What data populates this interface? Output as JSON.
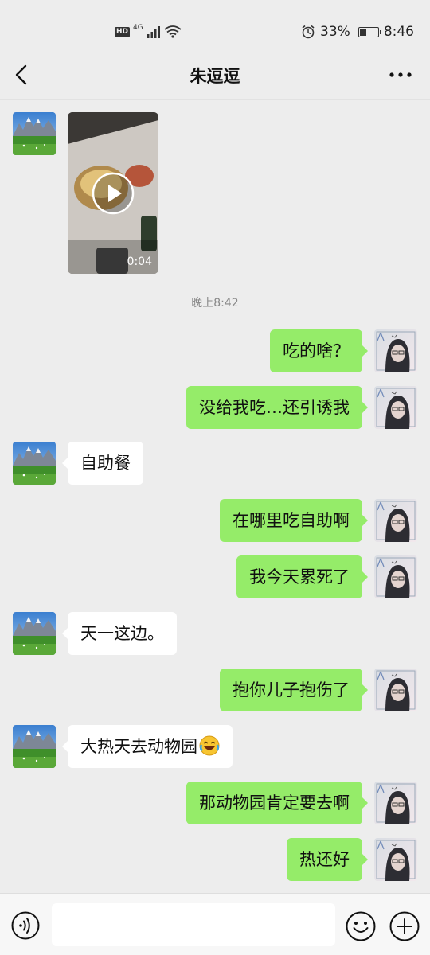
{
  "status_bar": {
    "hd": "HD",
    "network": "4G",
    "battery": "33%",
    "time": "8:46",
    "icons": [
      "hd-icon",
      "signal-icon",
      "wifi-icon",
      "alarm-icon",
      "battery-icon"
    ]
  },
  "header": {
    "title": "朱逗逗",
    "back_icon": "chevron-left-icon",
    "more_icon": "more-dots-icon"
  },
  "messages": [
    {
      "side": "left",
      "type": "video",
      "duration": "0:04"
    },
    {
      "type": "time",
      "text": "晚上8:42"
    },
    {
      "side": "right",
      "text": "吃的啥？"
    },
    {
      "side": "right",
      "text": "没给我吃…还引诱我"
    },
    {
      "side": "left",
      "text": "自助餐"
    },
    {
      "side": "right",
      "text": "在哪里吃自助啊"
    },
    {
      "side": "right",
      "text": "我今天累死了"
    },
    {
      "side": "left",
      "text": "天一这边。"
    },
    {
      "side": "right",
      "text": "抱你儿子抱伤了"
    },
    {
      "side": "left",
      "text": "大热天去动物园",
      "emoji": "laughing-crying-emoji-icon"
    },
    {
      "side": "right",
      "text": "那动物园肯定要去啊"
    },
    {
      "side": "right",
      "text": "热还好"
    }
  ],
  "input_bar": {
    "value": "",
    "icons": [
      "voice-icon",
      "emoji-face-icon",
      "plus-icon"
    ]
  },
  "colors": {
    "background": "#ededed",
    "sent_bubble": "#95ec69",
    "received_bubble": "#ffffff",
    "timestamp": "#888888"
  }
}
